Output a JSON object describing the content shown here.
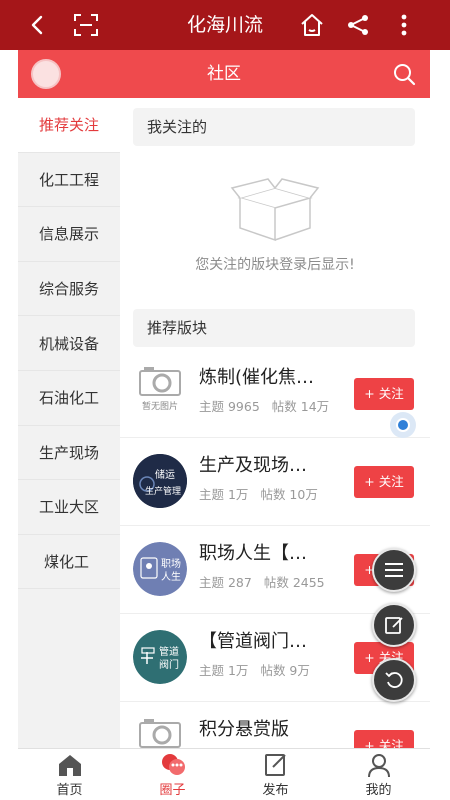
{
  "titlebar": {
    "title": "化海川流"
  },
  "header": {
    "title": "社区"
  },
  "categories": [
    {
      "label": "推荐关注",
      "active": true
    },
    {
      "label": "化工工程"
    },
    {
      "label": "信息展示"
    },
    {
      "label": "综合服务"
    },
    {
      "label": "机械设备"
    },
    {
      "label": "石油化工"
    },
    {
      "label": "生产现场"
    },
    {
      "label": "工业大区"
    },
    {
      "label": "煤化工"
    }
  ],
  "following": {
    "title": "我关注的",
    "empty_text": "您关注的版块登录后显示!"
  },
  "recommended": {
    "title": "推荐版块",
    "boards": [
      {
        "name": "炼制(催化焦…",
        "topics": "主题 9965",
        "posts": "帖数 14万",
        "follow": "+ 关注",
        "thumb_text": "暂无图片"
      },
      {
        "name": "生产及现场…",
        "topics": "主题 1万",
        "posts": "帖数 10万",
        "follow": "+ 关注",
        "thumb_text": "储运生产管理"
      },
      {
        "name": "职场人生【…",
        "topics": "主题 287",
        "posts": "帖数 2455",
        "follow": "+ 关注",
        "thumb_text": "职场人生"
      },
      {
        "name": "【管道阀门…",
        "topics": "主题 1万",
        "posts": "帖数 9万",
        "follow": "+ 关注",
        "thumb_text": "管道阀门"
      },
      {
        "name": "积分悬赏版",
        "topics": "",
        "posts": "",
        "follow": "+ 关注",
        "thumb_text": ""
      }
    ]
  },
  "nav": [
    {
      "label": "首页",
      "icon": "home-icon"
    },
    {
      "label": "圈子",
      "icon": "circle-chat-icon",
      "active": true
    },
    {
      "label": "发布",
      "icon": "publish-icon"
    },
    {
      "label": "我的",
      "icon": "profile-icon"
    }
  ],
  "colors": {
    "titlebar": "#a51619",
    "header": "#ef4a4d",
    "accent": "#e33a3c"
  }
}
